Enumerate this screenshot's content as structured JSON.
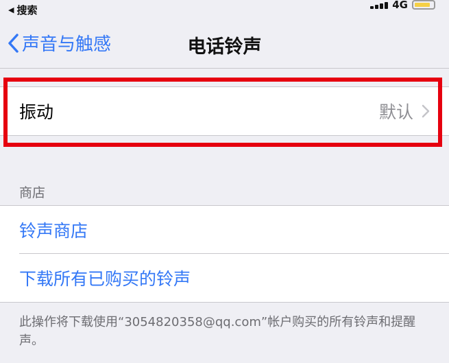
{
  "status_bar": {
    "back_app": "搜索",
    "network": "4G"
  },
  "nav": {
    "back_label": "声音与触感",
    "title": "电话铃声"
  },
  "vibration_cell": {
    "label": "振动",
    "value": "默认"
  },
  "store_section": {
    "header": "商店",
    "items": [
      {
        "label": "铃声商店"
      },
      {
        "label": "下载所有已购买的铃声"
      }
    ],
    "footer": "此操作将下载使用“3054820358@qq.com”帐户购买的所有铃声和提醒声。"
  },
  "colors": {
    "accent": "#3478f6",
    "highlight": "#e6000f",
    "background": "#efeff4",
    "secondary_text": "#8e8e93"
  }
}
